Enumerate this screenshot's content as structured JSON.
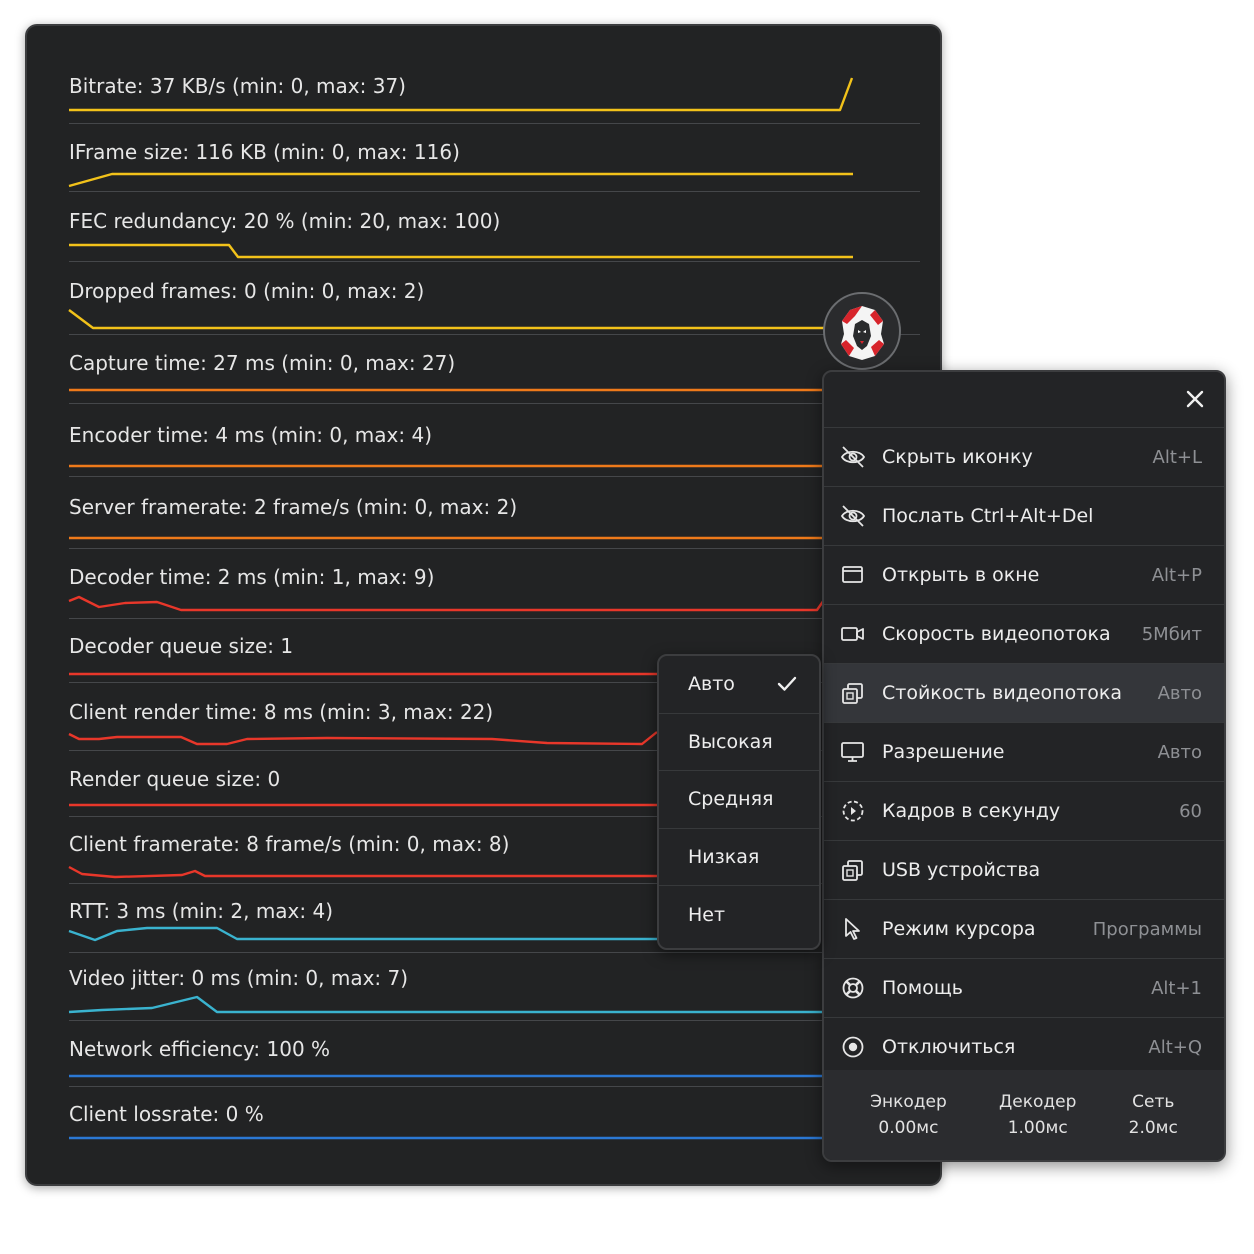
{
  "stats": [
    {
      "label": "Bitrate: 37 KB/s (min: 0, max: 37)",
      "color": "#f2c21a"
    },
    {
      "label": "IFrame size: 116 KB (min: 0, max: 116)",
      "color": "#f2c21a"
    },
    {
      "label": "FEC redundancy: 20 % (min: 20, max: 100)",
      "color": "#f2c21a"
    },
    {
      "label": "Dropped frames: 0  (min: 0, max: 2)",
      "color": "#f2c21a"
    },
    {
      "label": "Capture time: 27 ms (min: 0, max: 27)",
      "color": "#ef7a1a"
    },
    {
      "label": "Encoder time: 4 ms (min: 0, max: 4)",
      "color": "#ef7a1a"
    },
    {
      "label": "Server framerate: 2 frame/s (min: 0, max: 2)",
      "color": "#ef7a1a"
    },
    {
      "label": "Decoder time: 2 ms (min: 1, max: 9)",
      "color": "#e8372a"
    },
    {
      "label": "Decoder queue size: 1",
      "color": "#e8372a"
    },
    {
      "label": "Client render time: 8 ms (min: 3, max: 22)",
      "color": "#e8372a"
    },
    {
      "label": "Render queue size: 0",
      "color": "#e8372a"
    },
    {
      "label": "Client framerate: 8 frame/s (min: 0, max: 8)",
      "color": "#e8372a"
    },
    {
      "label": "RTT: 3 ms (min: 2, max: 4)",
      "color": "#3ab3cf"
    },
    {
      "label": "Video jitter: 0 ms (min: 0, max: 7)",
      "color": "#3ab3cf"
    },
    {
      "label": "Network efficiency: 100 %",
      "color": "#2b78d4"
    },
    {
      "label": "Client lossrate: 0 %",
      "color": "#2b78d4"
    }
  ],
  "menu": {
    "items": [
      {
        "icon": "eye-off-icon",
        "label": "Скрыть иконку",
        "value": "Alt+L"
      },
      {
        "icon": "eye-off-icon",
        "label": "Послать Ctrl+Alt+Del",
        "value": ""
      },
      {
        "icon": "window-icon",
        "label": "Открыть в окне",
        "value": "Alt+P"
      },
      {
        "icon": "video-camera-icon",
        "label": "Скорость видеопотока",
        "value": "5Мбит"
      },
      {
        "icon": "copy-stack-icon",
        "label": "Стойкость видеопотока",
        "value": "Авто"
      },
      {
        "icon": "monitor-icon",
        "label": "Разрешение",
        "value": "Авто"
      },
      {
        "icon": "fps-dial-icon",
        "label": "Кадров в секунду",
        "value": "60"
      },
      {
        "icon": "usb-stack-icon",
        "label": "USB устройства",
        "value": ""
      },
      {
        "icon": "cursor-arrow-icon",
        "label": "Режим курсора",
        "value": "Программы"
      },
      {
        "icon": "lifebuoy-icon",
        "label": "Помощь",
        "value": "Alt+1"
      },
      {
        "icon": "power-icon",
        "label": "Отключиться",
        "value": "Alt+Q"
      }
    ],
    "footer": [
      {
        "name": "Энкодер",
        "value": "0.00мс"
      },
      {
        "name": "Декодер",
        "value": "1.00мс"
      },
      {
        "name": "Сеть",
        "value": "2.0мс"
      }
    ]
  },
  "submenu": {
    "options": [
      "Авто",
      "Высокая",
      "Средняя",
      "Низкая",
      "Нет"
    ],
    "selected": "Авто"
  }
}
